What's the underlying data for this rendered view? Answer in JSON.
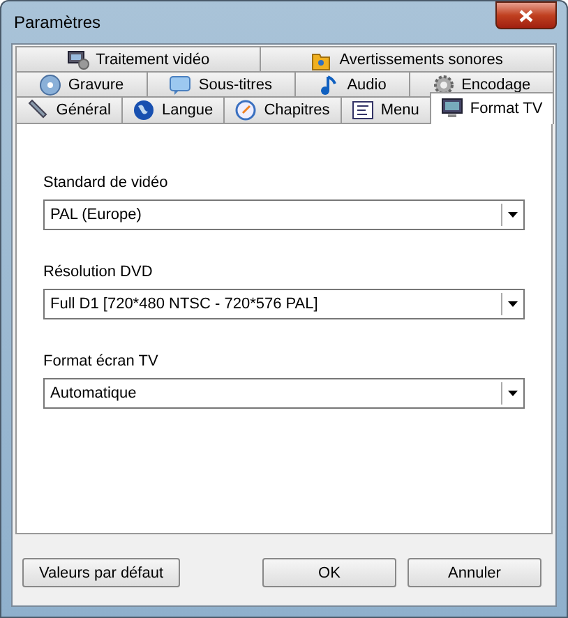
{
  "window": {
    "title": "Paramètres"
  },
  "tab_rows": [
    [
      {
        "label": "Traitement vidéo",
        "selected": false
      },
      {
        "label": "Avertissements sonores",
        "selected": false
      }
    ],
    [
      {
        "label": "Gravure",
        "selected": false
      },
      {
        "label": "Sous-titres",
        "selected": false
      },
      {
        "label": "Audio",
        "selected": false
      },
      {
        "label": "Encodage",
        "selected": false
      }
    ],
    [
      {
        "label": "Général",
        "selected": false
      },
      {
        "label": "Langue",
        "selected": false
      },
      {
        "label": "Chapitres",
        "selected": false
      },
      {
        "label": "Menu",
        "selected": false
      },
      {
        "label": "Format TV",
        "selected": true
      }
    ]
  ],
  "fields": [
    {
      "label": "Standard de vidéo",
      "value": "PAL (Europe)"
    },
    {
      "label": "Résolution DVD",
      "value": "Full D1 [720*480 NTSC - 720*576 PAL]"
    },
    {
      "label": "Format écran TV",
      "value": "Automatique"
    }
  ],
  "buttons": [
    {
      "label": "Valeurs par défaut",
      "kind": "left"
    },
    {
      "label": "OK",
      "kind": "right"
    },
    {
      "label": "Annuler",
      "kind": "right"
    }
  ]
}
